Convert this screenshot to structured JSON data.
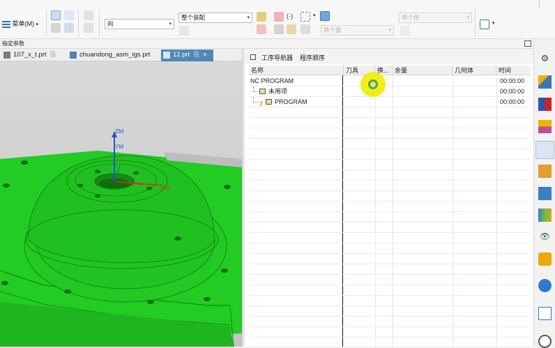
{
  "toolbar": {
    "menu_label": "菜单(M)",
    "menu_arrow": "▾",
    "type_filter": "",
    "direction_combo": "向",
    "assembly_combo": "整个装配",
    "body_combo": "单个体",
    "face_combo": "单个面",
    "dropdown_arrow": "▾"
  },
  "selection_bar": {
    "title": "指定参数"
  },
  "tabs": [
    {
      "label": "107_x_t.prt",
      "active": false
    },
    {
      "label": "chuandong_asm_igs.prt",
      "active": false
    },
    {
      "label": "12.prt",
      "active": true,
      "close": "×"
    }
  ],
  "viewport": {
    "axis_zm": "ZM",
    "axis_ym": "YM",
    "axis_xm": "XM",
    "colors": {
      "part_green": "#22cc22",
      "z_axis": "#1f56c9",
      "x_axis": "#e02a2a"
    }
  },
  "navigator": {
    "tools": [
      "工序导航器",
      "程序顺序"
    ],
    "columns": [
      "名称",
      "刀具",
      "换...",
      "余量",
      "几何体",
      "时间"
    ],
    "rows": [
      {
        "name": "NC PROGRAM",
        "time": "00:00:00",
        "indent": 0
      },
      {
        "name": "未用项",
        "time": "00:00:00",
        "indent": 1
      },
      {
        "name": "PROGRAM",
        "time": "00:00:00",
        "indent": 1
      }
    ]
  },
  "cursor": {
    "color": "#f4ee00"
  },
  "rail": {
    "icons": [
      "gear-icon",
      "operation-icon",
      "machine-tool-icon",
      "geometry-icon",
      "operation-navigator-icon",
      "assembly-icon",
      "constraint-icon",
      "roles-icon",
      "history-icon",
      "reuse-library-icon",
      "internet-icon",
      "document-icon",
      "clock-icon"
    ]
  }
}
